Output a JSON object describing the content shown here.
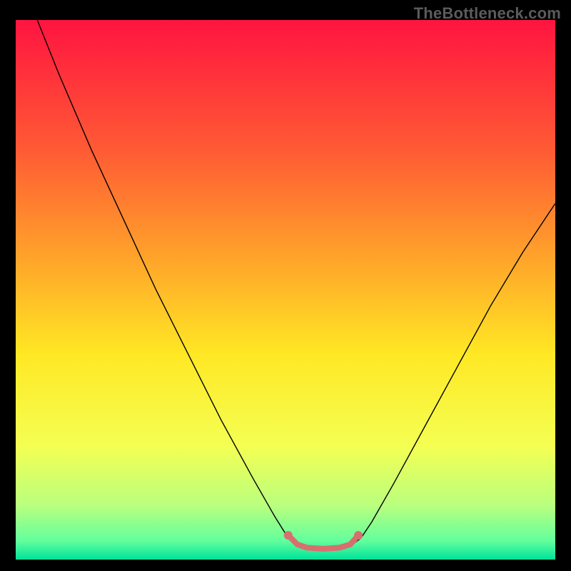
{
  "watermark": {
    "text": "TheBottleneck.com"
  },
  "chart_data": {
    "type": "line",
    "title": "",
    "xlabel": "",
    "ylabel": "",
    "xlim": [
      0,
      100
    ],
    "ylim": [
      0,
      100
    ],
    "grid": false,
    "legend": false,
    "background_gradient_stops": [
      {
        "offset": 0.0,
        "color": "#ff1440"
      },
      {
        "offset": 0.24,
        "color": "#ff5a34"
      },
      {
        "offset": 0.44,
        "color": "#ffa32a"
      },
      {
        "offset": 0.62,
        "color": "#ffe824"
      },
      {
        "offset": 0.79,
        "color": "#f4ff53"
      },
      {
        "offset": 0.9,
        "color": "#b9ff7e"
      },
      {
        "offset": 0.965,
        "color": "#63ff9d"
      },
      {
        "offset": 1.0,
        "color": "#00e29a"
      }
    ],
    "series": [
      {
        "name": "bottleneck-curve",
        "stroke": "#000000",
        "stroke_width": 1.4,
        "points": [
          {
            "x": 4.0,
            "y": 100.0
          },
          {
            "x": 8.0,
            "y": 90.0
          },
          {
            "x": 14.0,
            "y": 76.0
          },
          {
            "x": 20.0,
            "y": 63.0
          },
          {
            "x": 26.0,
            "y": 50.0
          },
          {
            "x": 32.0,
            "y": 38.0
          },
          {
            "x": 38.0,
            "y": 26.0
          },
          {
            "x": 44.0,
            "y": 15.0
          },
          {
            "x": 48.0,
            "y": 8.0
          },
          {
            "x": 50.5,
            "y": 4.0
          },
          {
            "x": 52.0,
            "y": 2.5
          },
          {
            "x": 54.0,
            "y": 2.0
          },
          {
            "x": 57.0,
            "y": 2.0
          },
          {
            "x": 60.0,
            "y": 2.0
          },
          {
            "x": 62.0,
            "y": 2.5
          },
          {
            "x": 64.0,
            "y": 4.0
          },
          {
            "x": 66.0,
            "y": 7.0
          },
          {
            "x": 70.0,
            "y": 14.0
          },
          {
            "x": 76.0,
            "y": 25.0
          },
          {
            "x": 82.0,
            "y": 36.0
          },
          {
            "x": 88.0,
            "y": 47.0
          },
          {
            "x": 94.0,
            "y": 57.0
          },
          {
            "x": 100.0,
            "y": 66.0
          }
        ]
      },
      {
        "name": "bottom-highlight",
        "stroke": "#d86f6f",
        "stroke_width": 8,
        "rounded": true,
        "points": [
          {
            "x": 50.5,
            "y": 4.5
          },
          {
            "x": 52.2,
            "y": 2.8
          },
          {
            "x": 54.0,
            "y": 2.2
          },
          {
            "x": 57.0,
            "y": 2.0
          },
          {
            "x": 60.0,
            "y": 2.2
          },
          {
            "x": 62.0,
            "y": 2.8
          },
          {
            "x": 63.5,
            "y": 4.5
          }
        ],
        "end_dots_radius": 6
      }
    ]
  }
}
